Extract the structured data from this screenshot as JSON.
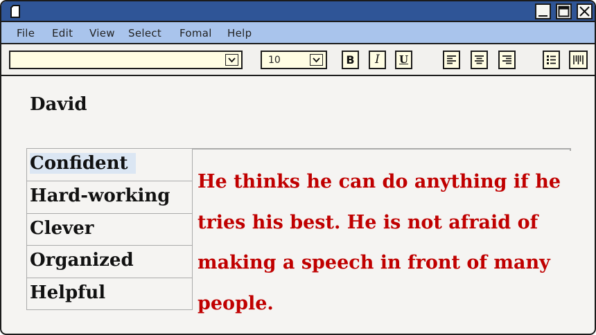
{
  "menu": {
    "file": "File",
    "edit": "Edit",
    "view": "View",
    "select": "Select",
    "fomal": "Fomal",
    "help": "Help"
  },
  "toolbar": {
    "font_value": "",
    "size_value": "10",
    "bold_label": "B",
    "italic_label": "I",
    "underline_label": "U"
  },
  "document": {
    "name": "David",
    "traits": [
      {
        "label": "Confident",
        "selected": true
      },
      {
        "label": "Hard-working",
        "selected": false
      },
      {
        "label": "Clever",
        "selected": false
      },
      {
        "label": "Organized",
        "selected": false
      },
      {
        "label": "Helpful",
        "selected": false
      }
    ],
    "description": "He thinks he can do anything if he tries his best. He is not afraid of making a speech in front of many people."
  },
  "colors": {
    "titlebar": "#2f5597",
    "menubar": "#a9c4ec",
    "input_bg": "#fffde3",
    "description_text": "#c00000",
    "selection_highlight": "#dbe6f3"
  }
}
